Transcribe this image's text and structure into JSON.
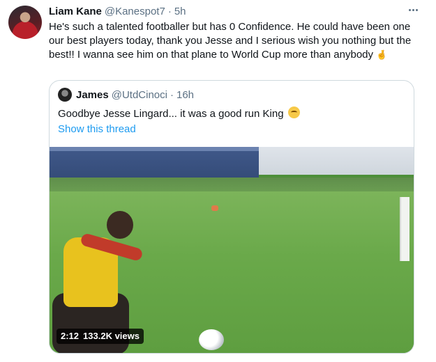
{
  "tweet": {
    "author_name": "Liam Kane",
    "author_handle": "@Kanespot7",
    "separator": "·",
    "time": "5h",
    "text": "He's such a talented footballer but has 0 Confidence. He could have been one our best players today, thank you Jesse and I serious wish you nothing but the best!! I wanna see him on that plane to World Cup more than anybody",
    "text_emoji": "🤞",
    "more_icon": "more-horizontal-icon"
  },
  "quoted": {
    "author_name": "James",
    "author_handle": "@UtdCinoci",
    "separator": "·",
    "time": "16h",
    "text": "Goodbye Jesse Lingard... it was a good run King",
    "text_emoji": "relieved-face",
    "show_thread": "Show this thread",
    "video": {
      "duration": "2:12",
      "views": "133.2K views"
    }
  },
  "colors": {
    "link": "#1d9bf0",
    "secondary_text": "#5b7083",
    "border": "#cfd9de"
  }
}
